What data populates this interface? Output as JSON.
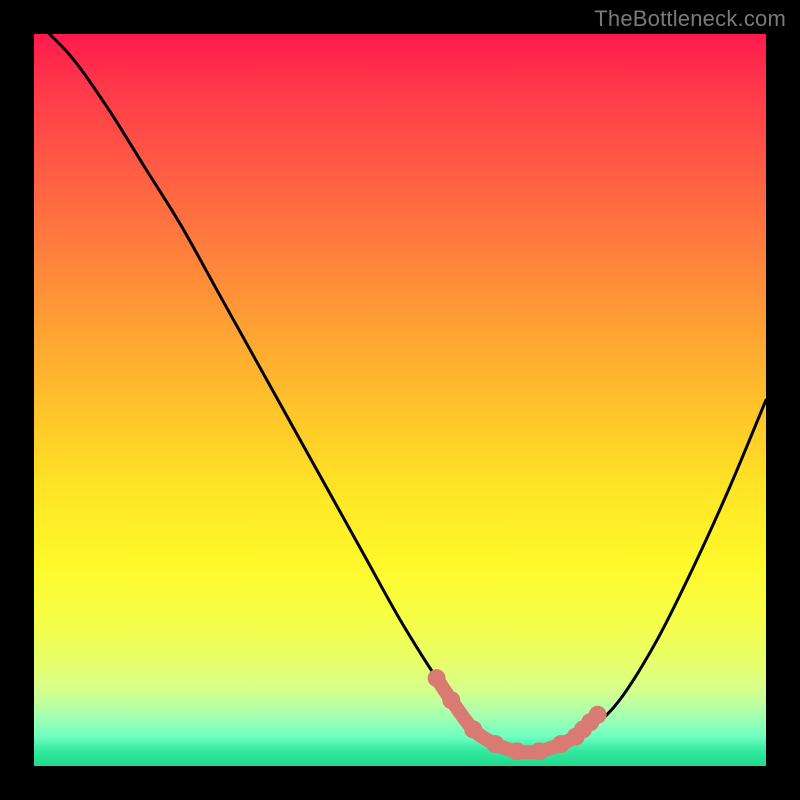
{
  "watermark": "TheBottleneck.com",
  "chart_data": {
    "type": "line",
    "title": "",
    "xlabel": "",
    "ylabel": "",
    "xlim": [
      0,
      100
    ],
    "ylim": [
      0,
      100
    ],
    "series": [
      {
        "name": "bottleneck-curve",
        "x": [
          0,
          5,
          10,
          15,
          20,
          25,
          30,
          35,
          40,
          45,
          50,
          55,
          58,
          60,
          62,
          65,
          68,
          70,
          73,
          76,
          80,
          85,
          90,
          95,
          100
        ],
        "values": [
          102,
          97,
          90,
          82,
          74,
          65,
          56,
          47,
          38,
          29,
          20,
          12,
          8,
          5,
          3,
          2,
          2,
          2,
          3,
          5,
          9,
          17,
          27,
          38,
          50
        ]
      }
    ],
    "highlight_points": {
      "name": "highlight",
      "color": "#d97b72",
      "x": [
        55,
        57,
        60,
        63,
        66,
        69,
        72,
        74,
        75,
        76,
        77
      ],
      "values": [
        12,
        9,
        5,
        3,
        2,
        2,
        3,
        4,
        5,
        6,
        7
      ]
    },
    "colors": {
      "background_top": "#ff1a4c",
      "background_bottom": "#1fd98a",
      "curve": "#000000",
      "highlight": "#d97b72"
    }
  }
}
